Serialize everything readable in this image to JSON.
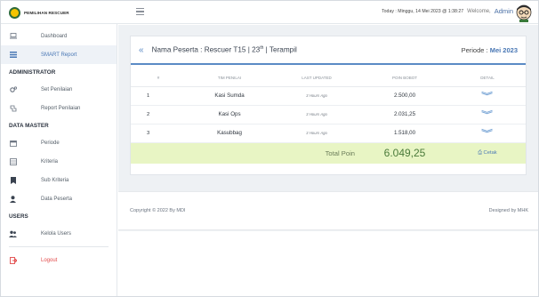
{
  "brand": {
    "name": "PEMILIHAN RESCUER"
  },
  "topbar": {
    "today_text": "Today : Minggu, 14 Mei 2023 @ 1:38:27",
    "welcome_text": "Welcome,",
    "admin_name": "Admin"
  },
  "sidebar": {
    "items_top": [
      {
        "label": "Dashboard",
        "icon": "laptop-icon"
      },
      {
        "label": "SMART Report",
        "icon": "list-icon"
      }
    ],
    "section_admin": "ADMINISTRATOR",
    "items_admin": [
      {
        "label": "Set Penilaian",
        "icon": "gears-icon"
      },
      {
        "label": "Report Penilaian",
        "icon": "report-icon"
      }
    ],
    "section_master": "DATA MASTER",
    "items_master": [
      {
        "label": "Periode",
        "icon": "calendar-icon"
      },
      {
        "label": "Kriteria",
        "icon": "grid-icon"
      },
      {
        "label": "Sub Kriteria",
        "icon": "bookmark-icon"
      },
      {
        "label": "Data Peserta",
        "icon": "user-icon"
      }
    ],
    "section_users": "USERS",
    "items_users": [
      {
        "label": "Kelola Users",
        "icon": "users-icon"
      }
    ],
    "logout": "Logout"
  },
  "card": {
    "title": "Nama Peserta : Rescuer T15 | 23",
    "title_sup": "th",
    "title_suffix": " | Terampil",
    "period_label": "Periode :",
    "period_value": "Mei 2023"
  },
  "table": {
    "headers": [
      "#",
      "TIM PENILAI",
      "LAST UPDATED",
      "POIN BOBOT",
      "DETAIL"
    ],
    "rows": [
      {
        "no": "1",
        "tim": "Kasi Sumda",
        "updated": "3 Hours Ago",
        "poin": "2.500,00"
      },
      {
        "no": "2",
        "tim": "Kasi Ops",
        "updated": "3 Hours Ago",
        "poin": "2.031,25"
      },
      {
        "no": "3",
        "tim": "Kasubbag",
        "updated": "3 Hours Ago",
        "poin": "1.518,00"
      }
    ],
    "total_label": "Total Poin",
    "total_value": "6.049,25",
    "print_label": "Cetak"
  },
  "footer": {
    "copyright": "Copyright © 2022 By MDI",
    "designed": "Designed by MHK"
  },
  "colors": {
    "accent": "#5b8bc5",
    "total_bg": "#e8f5c4",
    "logout": "#e24a4a"
  }
}
